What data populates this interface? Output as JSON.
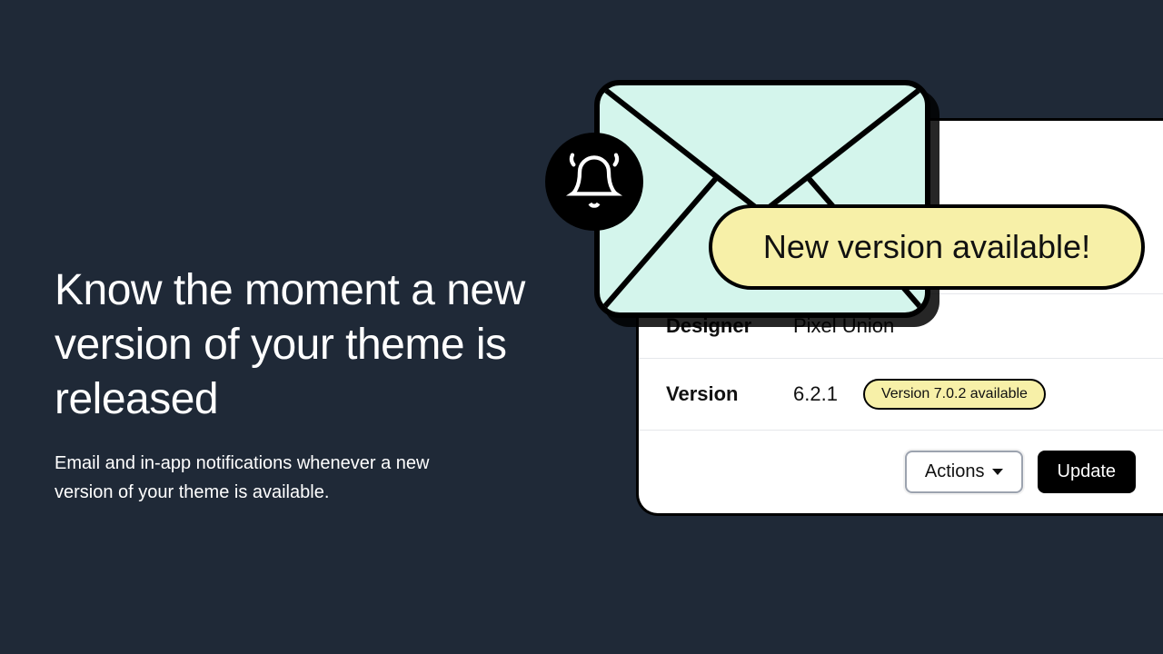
{
  "headline": "Know the moment a new version of your theme is released",
  "subtext": "Email and in-app notifications whenever a new version of your theme is available.",
  "toast": "New version available!",
  "card": {
    "designer_label": "Designer",
    "designer_value": "Pixel Union",
    "version_label": "Version",
    "version_value": "6.2.1",
    "version_badge": "Version 7.0.2 available",
    "actions_button": "Actions",
    "update_button": "Update"
  }
}
